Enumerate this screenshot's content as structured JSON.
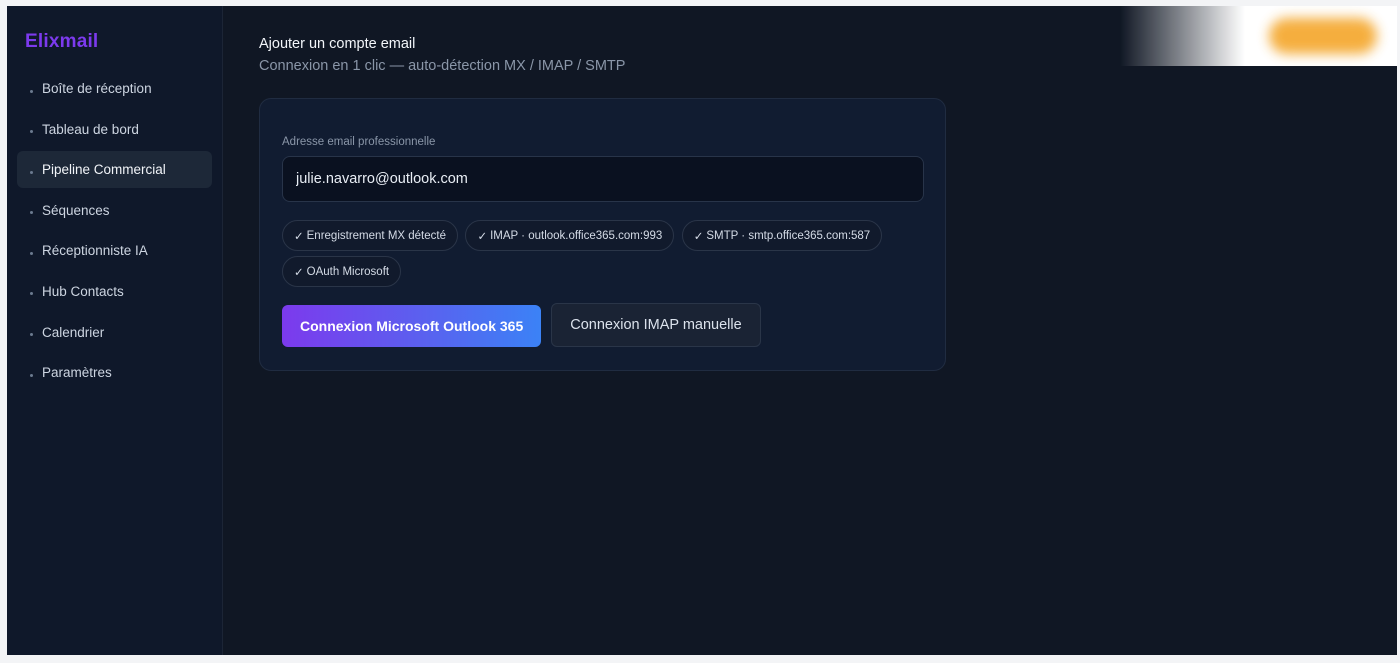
{
  "app": {
    "name": "Elixmail"
  },
  "sidebar": {
    "items": [
      {
        "label": "Boîte de réception"
      },
      {
        "label": "Tableau de bord"
      },
      {
        "label": "Pipeline Commercial",
        "active": true
      },
      {
        "label": "Séquences"
      },
      {
        "label": "Réceptionniste IA"
      },
      {
        "label": "Hub Contacts"
      },
      {
        "label": "Calendrier"
      },
      {
        "label": "Paramètres"
      }
    ]
  },
  "header": {
    "title": "Ajouter un compte email",
    "subtitle": "Connexion en 1 clic — auto-détection MX / IMAP / SMTP"
  },
  "form": {
    "email_label": "Adresse email professionnelle",
    "email_value": "julie.navarro@outlook.com",
    "chips": [
      {
        "check": "✓",
        "text": "Enregistrement MX détecté"
      },
      {
        "check": "✓",
        "text": "IMAP · outlook.office365.com:993"
      },
      {
        "check": "✓",
        "text": "SMTP · smtp.office365.com:587"
      },
      {
        "check": "✓",
        "text": "OAuth Microsoft"
      }
    ],
    "primary_button": "Connexion Microsoft Outlook 365",
    "secondary_button": "Connexion IMAP manuelle"
  },
  "colors": {
    "brand": "#7c3aed",
    "gradient_start": "#7c3aed",
    "gradient_end": "#3b82f6",
    "background": "#101724",
    "sidebar": "#0f182a",
    "card": "#111c31"
  }
}
